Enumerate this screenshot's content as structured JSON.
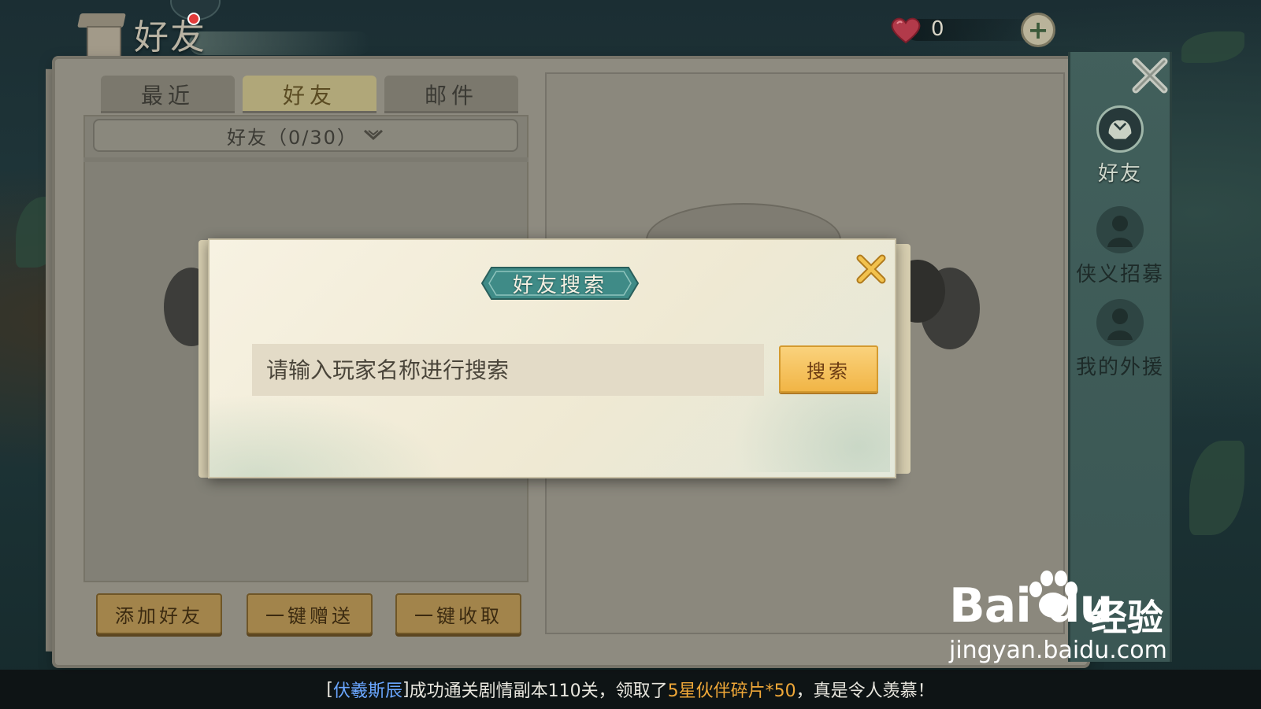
{
  "header": {
    "title": "好友"
  },
  "currency": {
    "value": "0"
  },
  "tabs": [
    {
      "label": "最近",
      "active": false
    },
    {
      "label": "好友",
      "active": true
    },
    {
      "label": "邮件",
      "active": false
    }
  ],
  "friend_group": {
    "label": "好友（0/30）"
  },
  "bottom_buttons": {
    "add_friend": "添加好友",
    "send_all": "一键赠送",
    "collect_all": "一键收取"
  },
  "side_nav": [
    {
      "label": "好友",
      "icon": "handshake-icon",
      "active": true
    },
    {
      "label": "侠义招募",
      "icon": "hero-recruit-icon",
      "active": false
    },
    {
      "label": "我的外援",
      "icon": "helper-icon",
      "active": false
    }
  ],
  "dialog": {
    "title": "好友搜索",
    "search_placeholder": "请输入玩家名称进行搜索",
    "search_button": "搜索"
  },
  "ticker": {
    "open": "[",
    "player": "伏羲斯辰",
    "close": "]",
    "text1": "成功通关剧情副本110关，领取了",
    "reward": "5星伙伴碎片*50",
    "text2": "，真是令人羡慕！"
  },
  "watermark": {
    "logo_text": "Bai du",
    "label": "经验",
    "url": "jingyan.baidu.com"
  },
  "colors": {
    "accent_gold": "#f1b546",
    "title_teal": "#3f8b87",
    "ticker_name": "#6aa6ff",
    "ticker_highlight": "#f0a838"
  }
}
